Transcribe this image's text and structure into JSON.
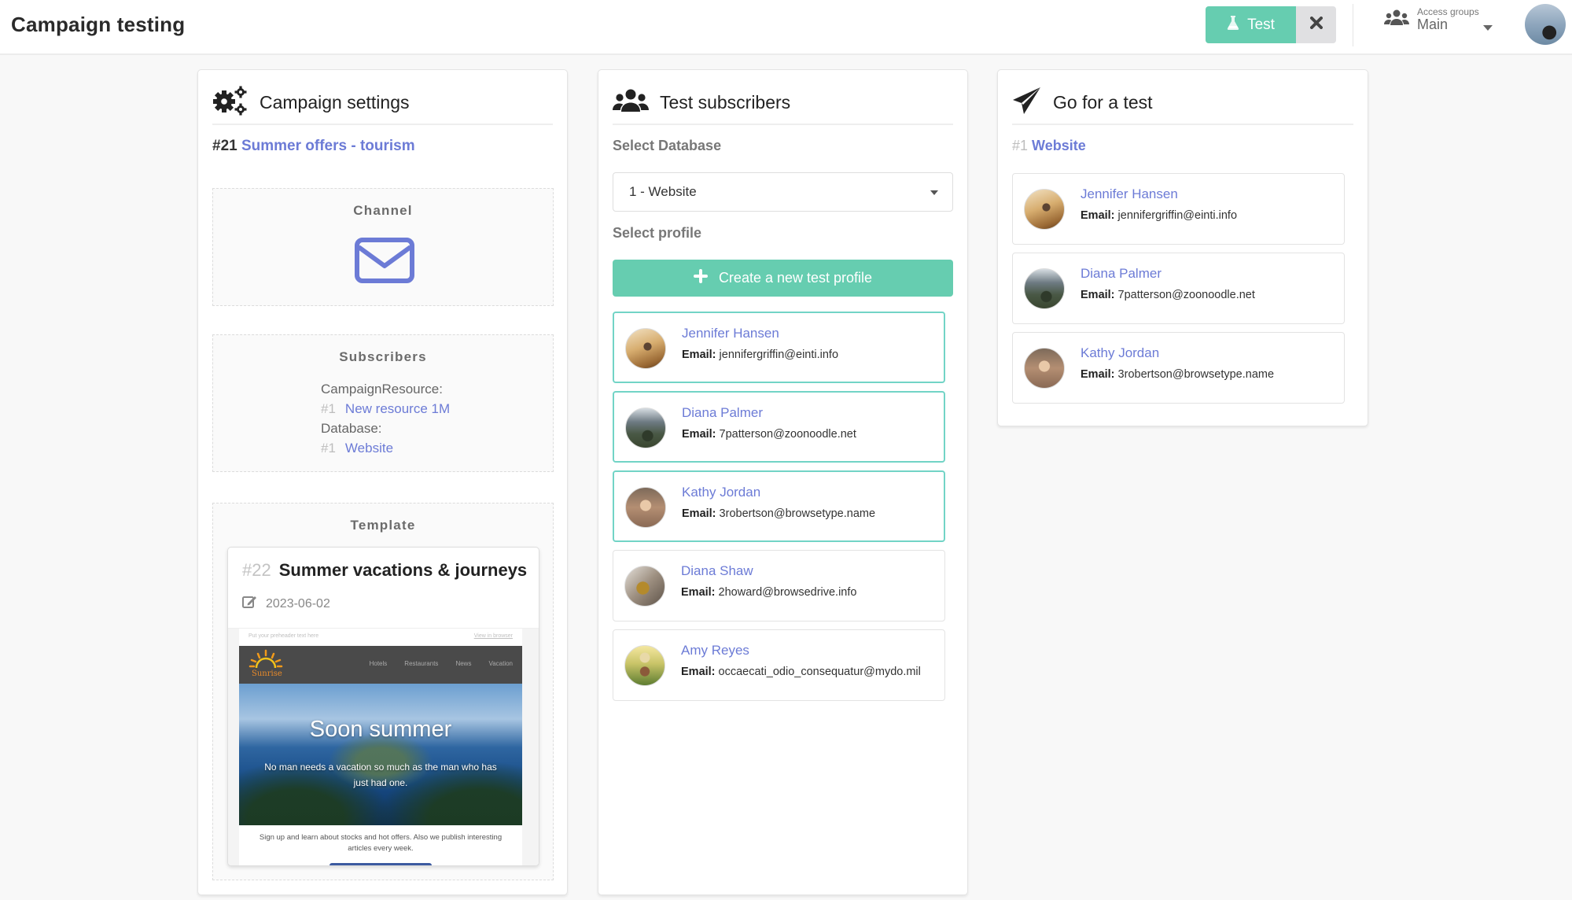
{
  "header": {
    "title": "Campaign testing",
    "test_button_label": "Test",
    "test_icon": "flask-icon",
    "close_icon": "close-icon",
    "access_groups_label": "Access groups",
    "access_groups_value": "Main",
    "access_groups_icon": "users-icon",
    "avatar_icon": "user-avatar"
  },
  "campaign_settings": {
    "title": "Campaign settings",
    "icon": "gears-icon",
    "campaign_id": "#21",
    "campaign_name": "Summer offers - tourism",
    "channel": {
      "title": "Channel",
      "icon": "envelope-icon"
    },
    "subscribers": {
      "title": "Subscribers",
      "resource_label": "CampaignResource:",
      "resource_id": "#1",
      "resource_name": "New resource 1M",
      "database_label": "Database:",
      "database_id": "#1",
      "database_name": "Website"
    },
    "template": {
      "title": "Template",
      "id": "#22",
      "name": "Summer vacations & journeys",
      "date": "2023-06-02",
      "date_icon": "edit-icon",
      "preview": {
        "preheader": "Put your preheader text here",
        "view_in_browser": "View in browser",
        "logo_text": "Sunrise",
        "nav_links": [
          "Hotels",
          "Restaurants",
          "News",
          "Vacation"
        ],
        "hero_title": "Soon summer",
        "hero_subtitle": "No man needs a vacation so much as the man who has just had one.",
        "footer_text": "Sign up and learn about stocks and hot offers. Also we publish interesting articles every week."
      }
    }
  },
  "test_subscribers": {
    "title": "Test subscribers",
    "icon": "users-icon",
    "select_database_label": "Select Database",
    "selected_database": "1 - Website",
    "select_profile_label": "Select profile",
    "create_button_label": "Create a new test profile",
    "email_label": "Email:",
    "profiles": [
      {
        "name": "Jennifer Hansen",
        "email": "jennifergriffin@einti.info",
        "selected": true
      },
      {
        "name": "Diana Palmer",
        "email": "7patterson@zoonoodle.net",
        "selected": true
      },
      {
        "name": "Kathy Jordan",
        "email": "3robertson@browsetype.name",
        "selected": true
      },
      {
        "name": "Diana Shaw",
        "email": "2howard@browsedrive.info",
        "selected": false
      },
      {
        "name": "Amy Reyes",
        "email": "occaecati_odio_consequatur@mydo.mil",
        "selected": false
      }
    ]
  },
  "go_for_test": {
    "title": "Go for a test",
    "icon": "paper-plane-icon",
    "database_id": "#1",
    "database_name": "Website",
    "email_label": "Email:",
    "recipients": [
      {
        "name": "Jennifer Hansen",
        "email": "jennifergriffin@einti.info"
      },
      {
        "name": "Diana Palmer",
        "email": "7patterson@zoonoodle.net"
      },
      {
        "name": "Kathy Jordan",
        "email": "3robertson@browsetype.name"
      }
    ]
  },
  "colors": {
    "accent_green": "#66cdb0",
    "link_blue": "#6c7bd6",
    "selected_border": "#72d4c6"
  }
}
